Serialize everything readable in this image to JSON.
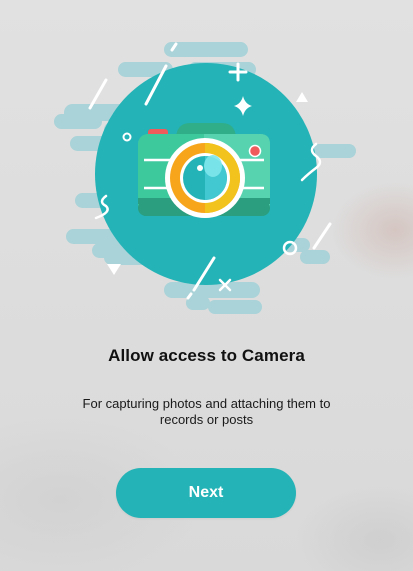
{
  "permission": {
    "title": "Allow access to Camera",
    "description": "For capturing photos and attaching them to records or posts",
    "next_label": "Next"
  },
  "colors": {
    "accent": "#24b3b6",
    "cloud": "#a9d3d8",
    "camera_body": "#3ec99d",
    "camera_top": "#2fae88",
    "lens_ring": "#f7a51b",
    "flash": "#ef5a5a"
  },
  "icons": [
    "camera-icon",
    "sparkle-icon",
    "plus-icon",
    "cross-icon",
    "triangle-icon",
    "circle-icon"
  ]
}
